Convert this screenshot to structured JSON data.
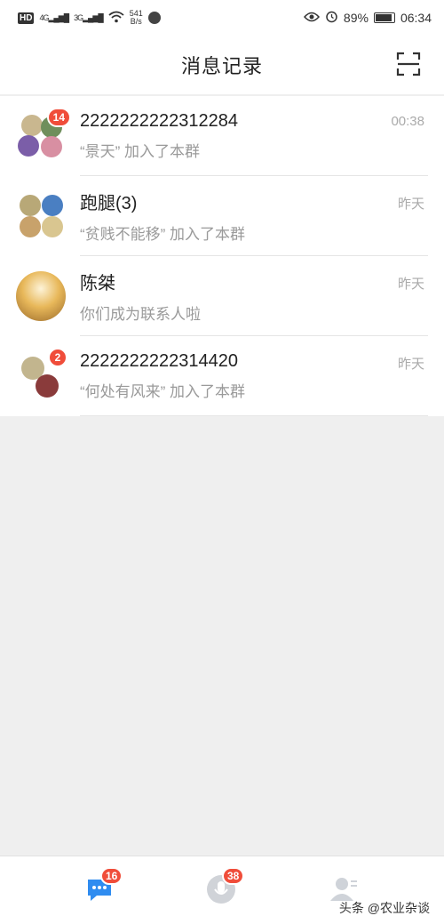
{
  "status_bar": {
    "left": {
      "hd": "HD",
      "net1": "4G",
      "net2": "3G",
      "speed_value": "541",
      "speed_unit": "B/s"
    },
    "right": {
      "battery": "89%",
      "time": "06:34"
    }
  },
  "header": {
    "title": "消息记录"
  },
  "messages": [
    {
      "name": "2222222222312284",
      "preview": "“景天” 加入了本群",
      "time": "00:38",
      "badge": "14"
    },
    {
      "name": "跑腿(3)",
      "preview": "“贫贱不能移” 加入了本群",
      "time": "昨天",
      "badge": ""
    },
    {
      "name": "陈桀",
      "preview": "你们成为联系人啦",
      "time": "昨天",
      "badge": ""
    },
    {
      "name": "2222222222314420",
      "preview": "“何处有风来” 加入了本群",
      "time": "昨天",
      "badge": "2"
    }
  ],
  "tabbar": {
    "messages_badge": "16",
    "voice_badge": "38",
    "watermark": "头条 @农业杂谈"
  },
  "colors": {
    "accent": "#2f8cf0",
    "badge": "#f04d3a"
  }
}
